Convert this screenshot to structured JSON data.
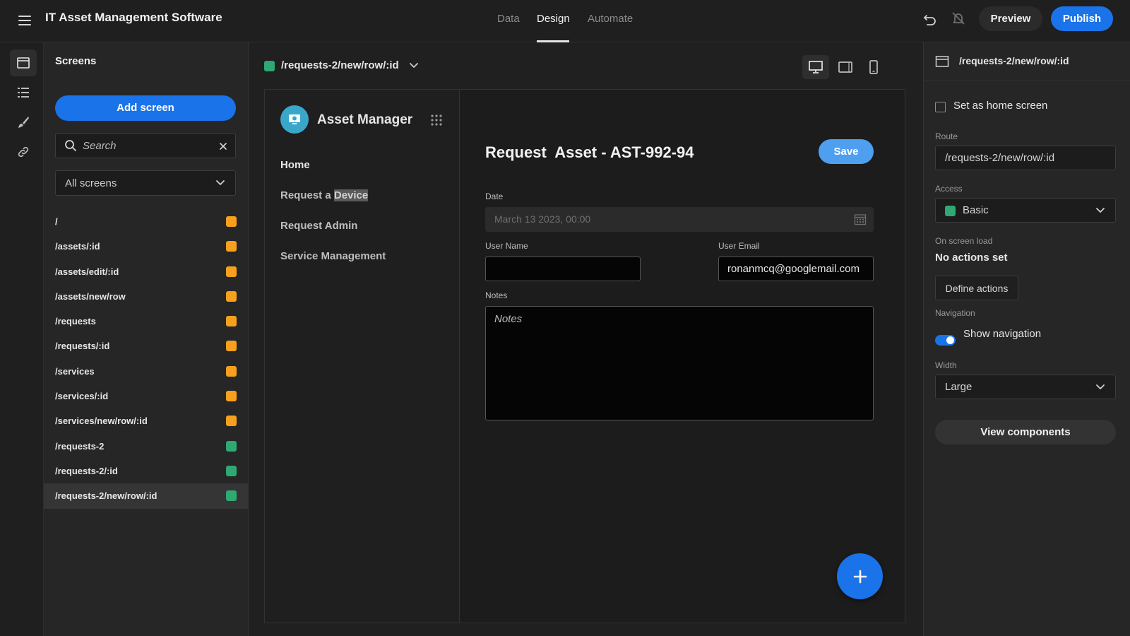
{
  "app": {
    "title": "IT Asset Management Software",
    "menu_icon": "hamburger-menu-icon"
  },
  "header": {
    "tabs": [
      {
        "label": "Data",
        "active": false
      },
      {
        "label": "Design",
        "active": true
      },
      {
        "label": "Automate",
        "active": false
      }
    ],
    "undo_icon": "undo-icon",
    "bell_icon": "notifications-off-icon",
    "preview_label": "Preview",
    "publish_label": "Publish"
  },
  "rail": {
    "items": [
      "screens-icon",
      "list-icon",
      "brush-icon",
      "link-icon"
    ]
  },
  "screens_panel": {
    "title": "Screens",
    "add_label": "Add screen",
    "search_placeholder": "Search",
    "filter_value": "All screens",
    "items": [
      {
        "label": "/",
        "color": "#f7a01e"
      },
      {
        "label": "/assets/:id",
        "color": "#f7a01e"
      },
      {
        "label": "/assets/edit/:id",
        "color": "#f7a01e"
      },
      {
        "label": "/assets/new/row",
        "color": "#f7a01e"
      },
      {
        "label": "/requests",
        "color": "#f7a01e"
      },
      {
        "label": "/requests/:id",
        "color": "#f7a01e"
      },
      {
        "label": "/services",
        "color": "#f7a01e"
      },
      {
        "label": "/services/:id",
        "color": "#f7a01e"
      },
      {
        "label": "/services/new/row/:id",
        "color": "#f7a01e"
      },
      {
        "label": "/requests-2",
        "color": "#2fa874"
      },
      {
        "label": "/requests-2/:id",
        "color": "#2fa874"
      },
      {
        "label": "/requests-2/new/row/:id",
        "color": "#2fa874",
        "active": true
      }
    ]
  },
  "canvas": {
    "route": "/requests-2/new/row/:id",
    "devices": [
      "desktop-icon",
      "tablet-icon",
      "mobile-icon"
    ],
    "preview": {
      "nav_title": "Asset Manager",
      "nav_links": [
        "Home",
        "Request a ",
        "Request Admin",
        "Service Management"
      ],
      "nav_link_highlight": "Device",
      "form_title": "Request  Asset - AST-992-94",
      "save_label": "Save",
      "date_label": "Date",
      "date_value": "March 13 2023, 00:00",
      "user_name_label": "User Name",
      "user_name_value": "",
      "user_email_label": "User Email",
      "user_email_value": "ronanmcq@googlemail.com",
      "notes_label": "Notes",
      "notes_placeholder": "Notes"
    }
  },
  "props": {
    "route": "/requests-2/new/row/:id",
    "home_label": "Set as home screen",
    "route_label": "Route",
    "route_value": "/requests-2/new/row/:id",
    "access_label": "Access",
    "access_value": "Basic",
    "access_color": "#2fa874",
    "onload_label": "On screen load",
    "onload_value": "No actions set",
    "define_label": "Define actions",
    "navigation_label": "Navigation",
    "show_nav_label": "Show navigation",
    "width_label": "Width",
    "width_value": "Large",
    "view_label": "View components"
  }
}
